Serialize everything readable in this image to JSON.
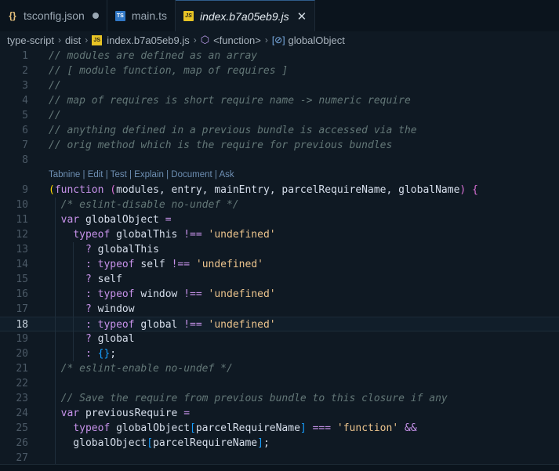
{
  "tabs": [
    {
      "label": "tsconfig.json",
      "icon": "json-icon",
      "modified": true,
      "active": false
    },
    {
      "label": "main.ts",
      "icon": "ts-icon",
      "active": false
    },
    {
      "label": "index.b7a05eb9.js",
      "icon": "js-icon",
      "active": true
    }
  ],
  "tab_icons": {
    "json": "{}",
    "ts": "TS",
    "js": "JS",
    "close": "✕"
  },
  "breadcrumb": {
    "parts": [
      "type-script",
      "dist",
      "index.b7a05eb9.js",
      "<function>",
      "globalObject"
    ],
    "separator": "›"
  },
  "codelens": [
    "Tabnine",
    "Edit",
    "Test",
    "Explain",
    "Document",
    "Ask"
  ],
  "codelens_separator": " | ",
  "current_line": 18,
  "colors": {
    "background": "#0f1923",
    "comment": "#637777",
    "keyword": "#c792ea",
    "string": "#ecc48d",
    "accent": "#2f5c8a"
  }
}
